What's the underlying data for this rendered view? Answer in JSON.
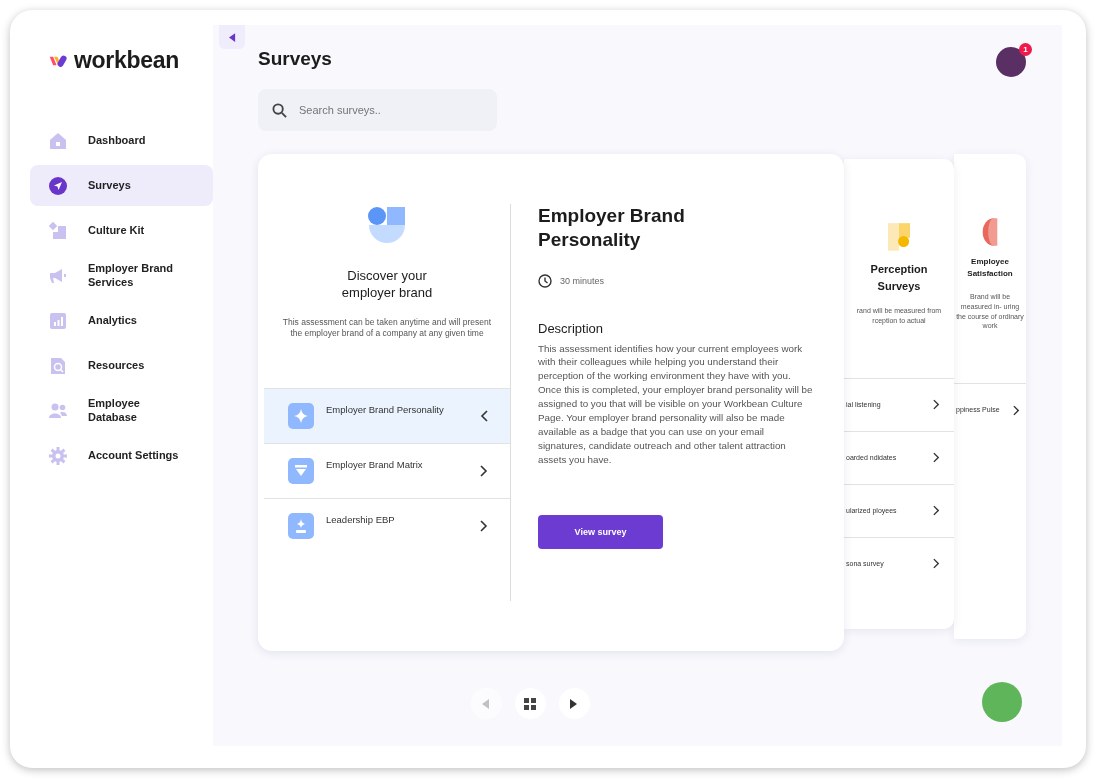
{
  "sidebar": {
    "logo": "workbean",
    "items": [
      {
        "label": "Dashboard",
        "selected": false
      },
      {
        "label": "Surveys",
        "selected": true
      },
      {
        "label": "Culture Kit",
        "selected": false
      },
      {
        "label": "Employer Brand Services",
        "selected": false
      },
      {
        "label": "Analytics",
        "selected": false
      },
      {
        "label": "Resources",
        "selected": false
      },
      {
        "label": "Employee Database",
        "selected": false
      },
      {
        "label": "Account Settings",
        "selected": false
      }
    ]
  },
  "header": {
    "title": "Surveys",
    "search": {
      "placeholder": "Search surveys.."
    },
    "notification_count": "1"
  },
  "survey_card": {
    "heading": "Discover your employer brand",
    "intro": "This assessment can be taken anytime and will present the employer brand of a company at any given time",
    "surveys": [
      {
        "label": "Employer Brand Personality",
        "selected": true
      },
      {
        "label": "Employer Brand Matrix",
        "selected": false
      },
      {
        "label": "Leadership EBP",
        "selected": false
      }
    ],
    "detail": {
      "title": "Employer Brand Personality",
      "duration": "30 minutes",
      "description_heading": "Description",
      "description": "This assessment identifies how your current employees work with their colleagues while helping you understand their perception of the working environment they have with you. Once this is completed, your employer brand personality will be assigned to you that will be visible on your Workbean Culture Page. Your employer brand personality will also be made available as a badge that you can use on your email signatures, candidate outreach and other talent attraction assets you have.",
      "button": "View survey"
    }
  },
  "back_cards": [
    {
      "title": "Perception Surveys",
      "description": "rand will be measured from rception to actual",
      "items": [
        "ial listening",
        "oarded ndidates",
        "ularized ployees",
        "sona survey"
      ]
    },
    {
      "title": "Employee Satisfaction",
      "description": "Brand will be measured in- uring the course of ordinary work",
      "items": [
        "ppiness Pulse"
      ]
    }
  ],
  "pager": {
    "prev_disabled": true
  }
}
